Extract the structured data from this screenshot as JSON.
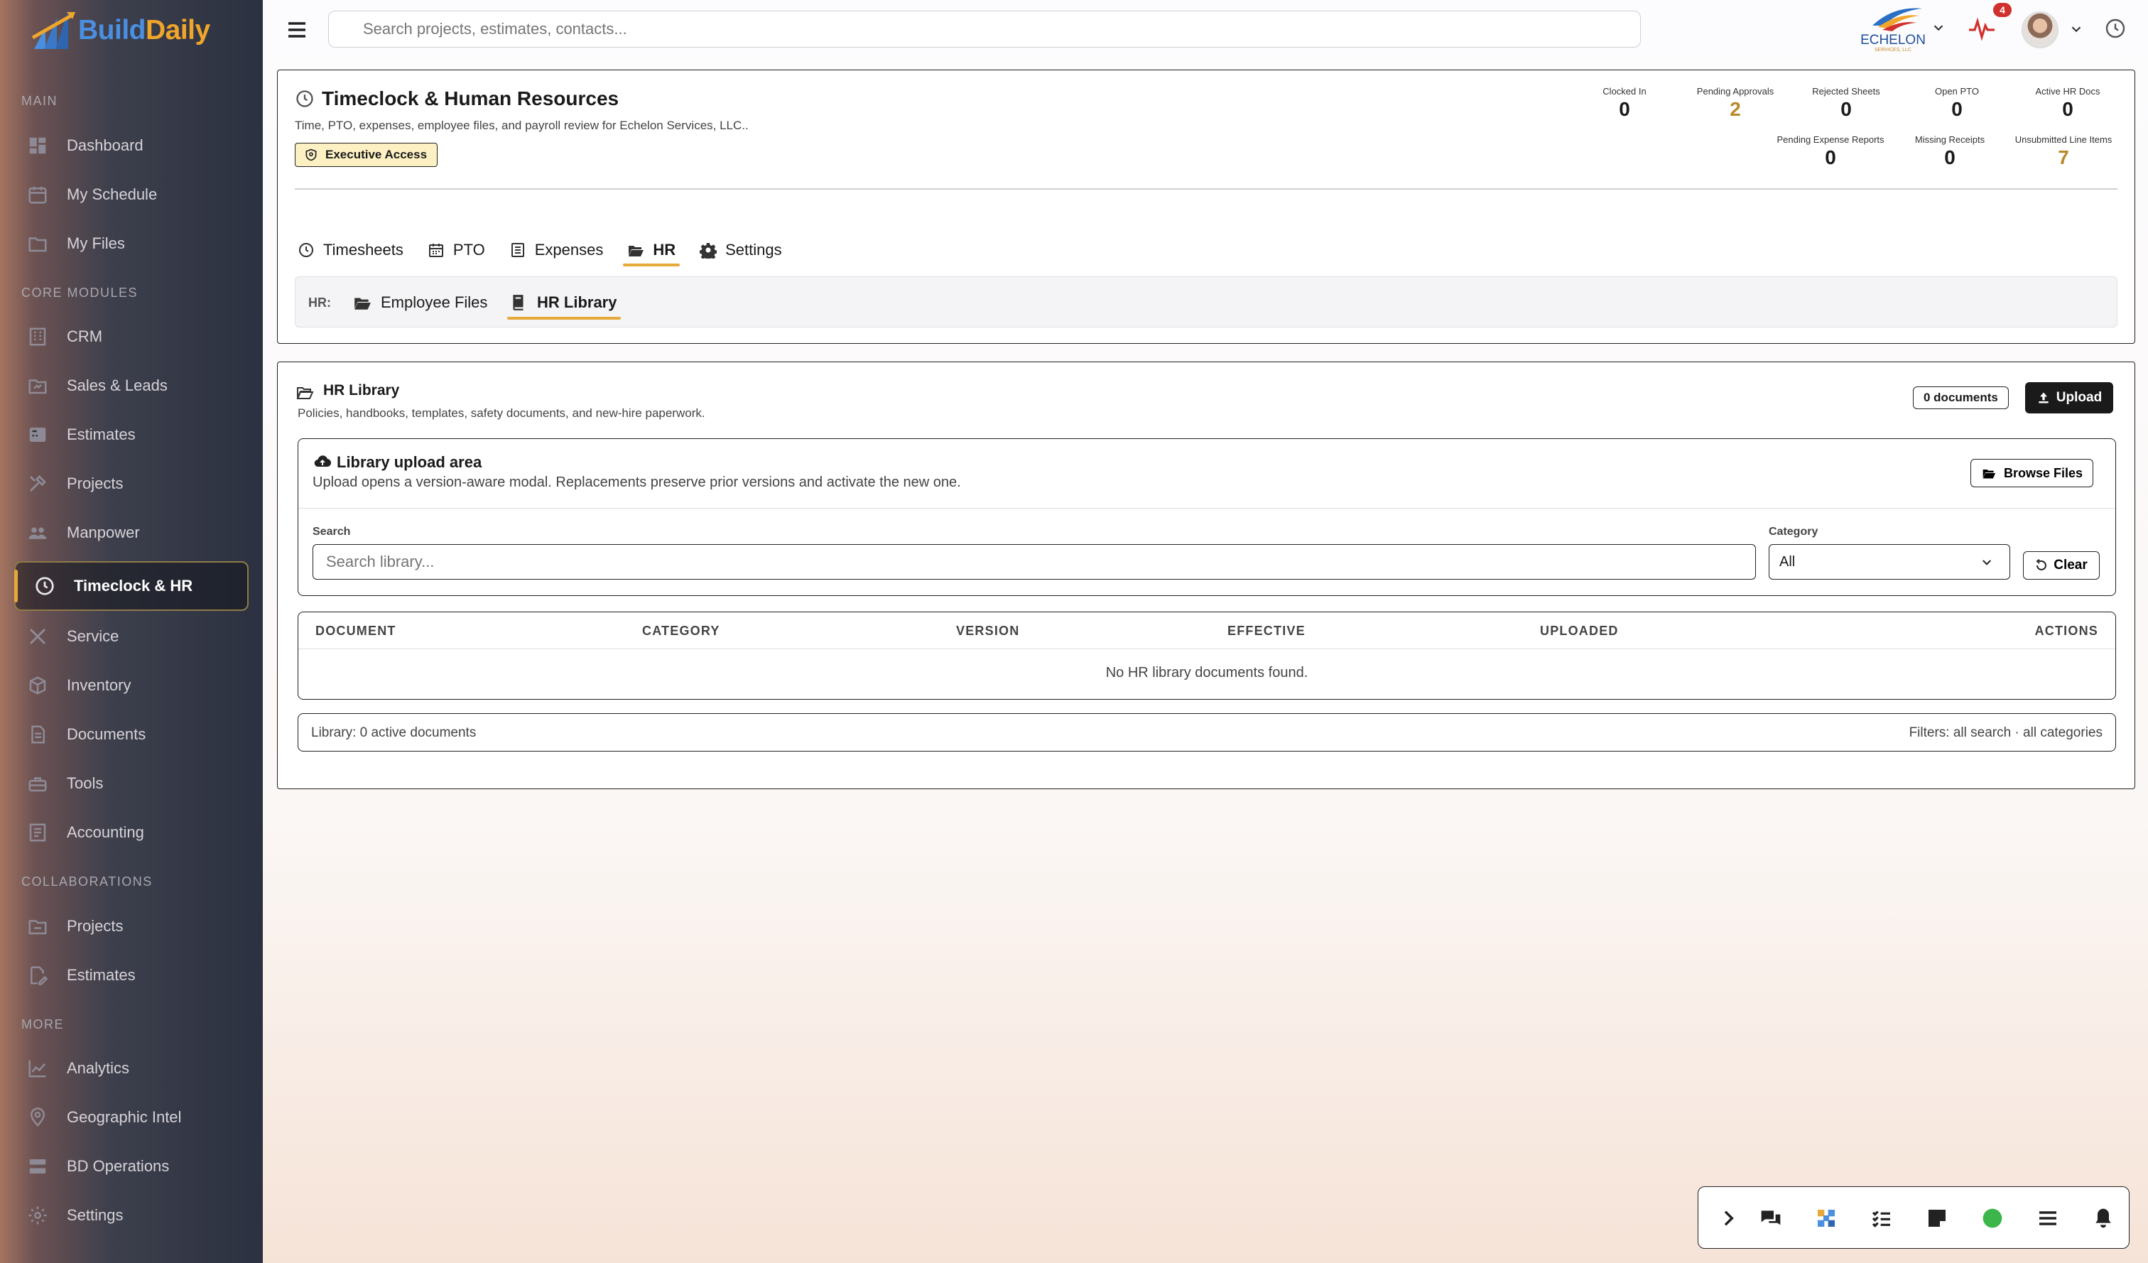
{
  "brand": {
    "name_part1": "Build",
    "name_part2": "Daily"
  },
  "sidebar": {
    "sections": {
      "main": "MAIN",
      "core": "CORE MODULES",
      "collab": "COLLABORATIONS",
      "more": "MORE"
    },
    "items": [
      {
        "label": "Dashboard",
        "icon": "dashboard-icon"
      },
      {
        "label": "My Schedule",
        "icon": "calendar-icon"
      },
      {
        "label": "My Files",
        "icon": "folder-icon"
      },
      {
        "label": "CRM",
        "icon": "building-icon"
      },
      {
        "label": "Sales & Leads",
        "icon": "leads-icon"
      },
      {
        "label": "Estimates",
        "icon": "calculator-icon"
      },
      {
        "label": "Projects",
        "icon": "tools-icon"
      },
      {
        "label": "Manpower",
        "icon": "people-icon"
      },
      {
        "label": "Timeclock & HR",
        "icon": "clock-icon",
        "active": true
      },
      {
        "label": "Service",
        "icon": "wrench-icon"
      },
      {
        "label": "Inventory",
        "icon": "box-icon"
      },
      {
        "label": "Documents",
        "icon": "document-icon"
      },
      {
        "label": "Tools",
        "icon": "toolbox-icon"
      },
      {
        "label": "Accounting",
        "icon": "ledger-icon"
      },
      {
        "label": "Projects",
        "icon": "folder-icon"
      },
      {
        "label": "Estimates",
        "icon": "edit-icon"
      },
      {
        "label": "Analytics",
        "icon": "chart-icon"
      },
      {
        "label": "Geographic Intel",
        "icon": "map-pin-icon"
      },
      {
        "label": "BD Operations",
        "icon": "server-icon"
      },
      {
        "label": "Settings",
        "icon": "gear-icon"
      }
    ]
  },
  "topbar": {
    "search_placeholder": "Search projects, estimates, contacts...",
    "notification_count": "4",
    "company_logo_text": "ECHELON",
    "company_logo_sub": "SERVICES, LLC"
  },
  "header": {
    "title": "Timeclock & Human Resources",
    "subtitle": "Time, PTO, expenses, employee files, and payroll review for Echelon Services, LLC..",
    "access_badge": "Executive Access",
    "stats": [
      {
        "label": "Clocked In",
        "value": "0"
      },
      {
        "label": "Pending Approvals",
        "value": "2",
        "accent": true
      },
      {
        "label": "Rejected Sheets",
        "value": "0"
      },
      {
        "label": "Open PTO",
        "value": "0"
      },
      {
        "label": "Active HR Docs",
        "value": "0"
      },
      {
        "label": "Pending Expense Reports",
        "value": "0"
      },
      {
        "label": "Missing Receipts",
        "value": "0"
      },
      {
        "label": "Unsubmitted Line Items",
        "value": "7",
        "accent": true
      }
    ]
  },
  "tabs": [
    {
      "label": "Timesheets",
      "icon": "clock-icon"
    },
    {
      "label": "PTO",
      "icon": "calendar-icon"
    },
    {
      "label": "Expenses",
      "icon": "receipt-icon"
    },
    {
      "label": "HR",
      "icon": "folder-open-icon",
      "active": true
    },
    {
      "label": "Settings",
      "icon": "gear-icon"
    }
  ],
  "subtabs": {
    "prefix": "HR:",
    "items": [
      {
        "label": "Employee Files",
        "icon": "folder-open-icon"
      },
      {
        "label": "HR Library",
        "icon": "book-icon",
        "active": true
      }
    ]
  },
  "library": {
    "title": "HR Library",
    "subtitle": "Policies, handbooks, templates, safety documents, and new-hire paperwork.",
    "doc_count": "0 documents",
    "upload_label": "Upload",
    "upload_area": {
      "title": "Library upload area",
      "subtitle": "Upload opens a version-aware modal. Replacements preserve prior versions and activate the new one.",
      "browse_label": "Browse Files"
    },
    "search_label": "Search",
    "search_placeholder": "Search library...",
    "category_label": "Category",
    "category_value": "All",
    "clear_label": "Clear",
    "columns": [
      "DOCUMENT",
      "CATEGORY",
      "VERSION",
      "EFFECTIVE",
      "UPLOADED",
      "ACTIONS"
    ],
    "empty_message": "No HR library documents found.",
    "footer_left": "Library: 0 active documents",
    "footer_right": "Filters: all search · all categories"
  },
  "colors": {
    "accent": "#e6a93a",
    "stat_accent": "#b8892a",
    "alert": "#d0312d"
  }
}
